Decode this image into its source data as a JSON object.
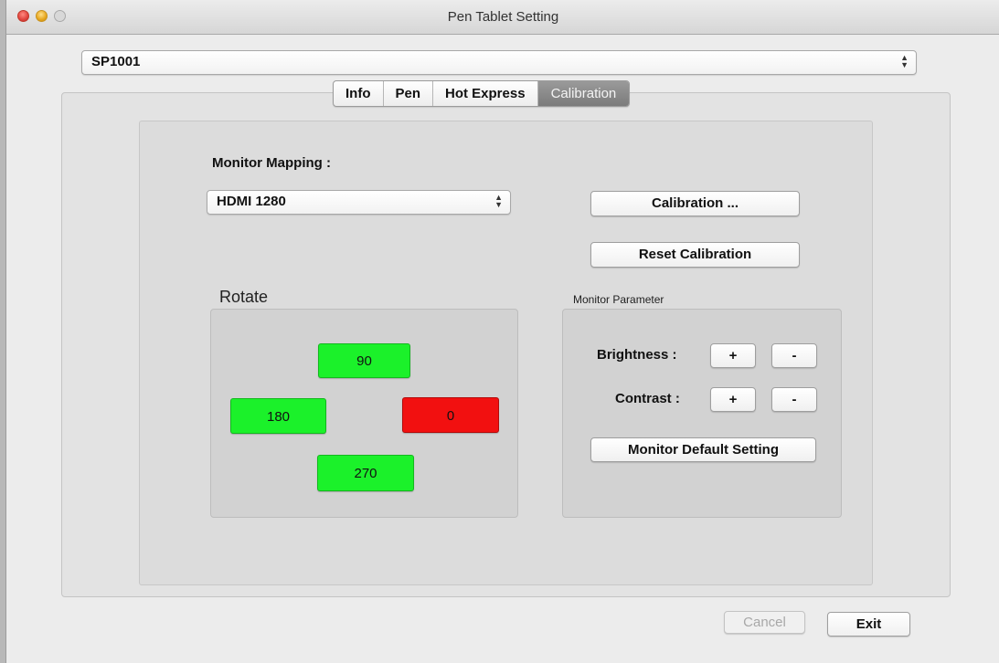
{
  "window": {
    "title": "Pen Tablet Setting"
  },
  "device_select": {
    "value": "SP1001"
  },
  "tabs": [
    {
      "label": "Info"
    },
    {
      "label": "Pen"
    },
    {
      "label": "Hot Express"
    },
    {
      "label": "Calibration",
      "selected": true
    }
  ],
  "calibration": {
    "monitor_mapping_label": "Monitor Mapping :",
    "monitor_select_value": "HDMI 1280",
    "calibration_button": "Calibration ...",
    "reset_button": "Reset Calibration"
  },
  "rotate": {
    "title": "Rotate",
    "buttons": {
      "r90": "90",
      "r180": "180",
      "r0": "0",
      "r270": "270"
    },
    "selected": "0",
    "colors": {
      "available": "#1bf12a",
      "selected": "#f21010"
    }
  },
  "monitor_parameter": {
    "title": "Monitor Parameter",
    "brightness_label": "Brightness :",
    "contrast_label": "Contrast :",
    "plus": "+",
    "minus": "-",
    "default_button": "Monitor Default Setting"
  },
  "footer": {
    "cancel_label": "Cancel",
    "exit_label": "Exit"
  }
}
